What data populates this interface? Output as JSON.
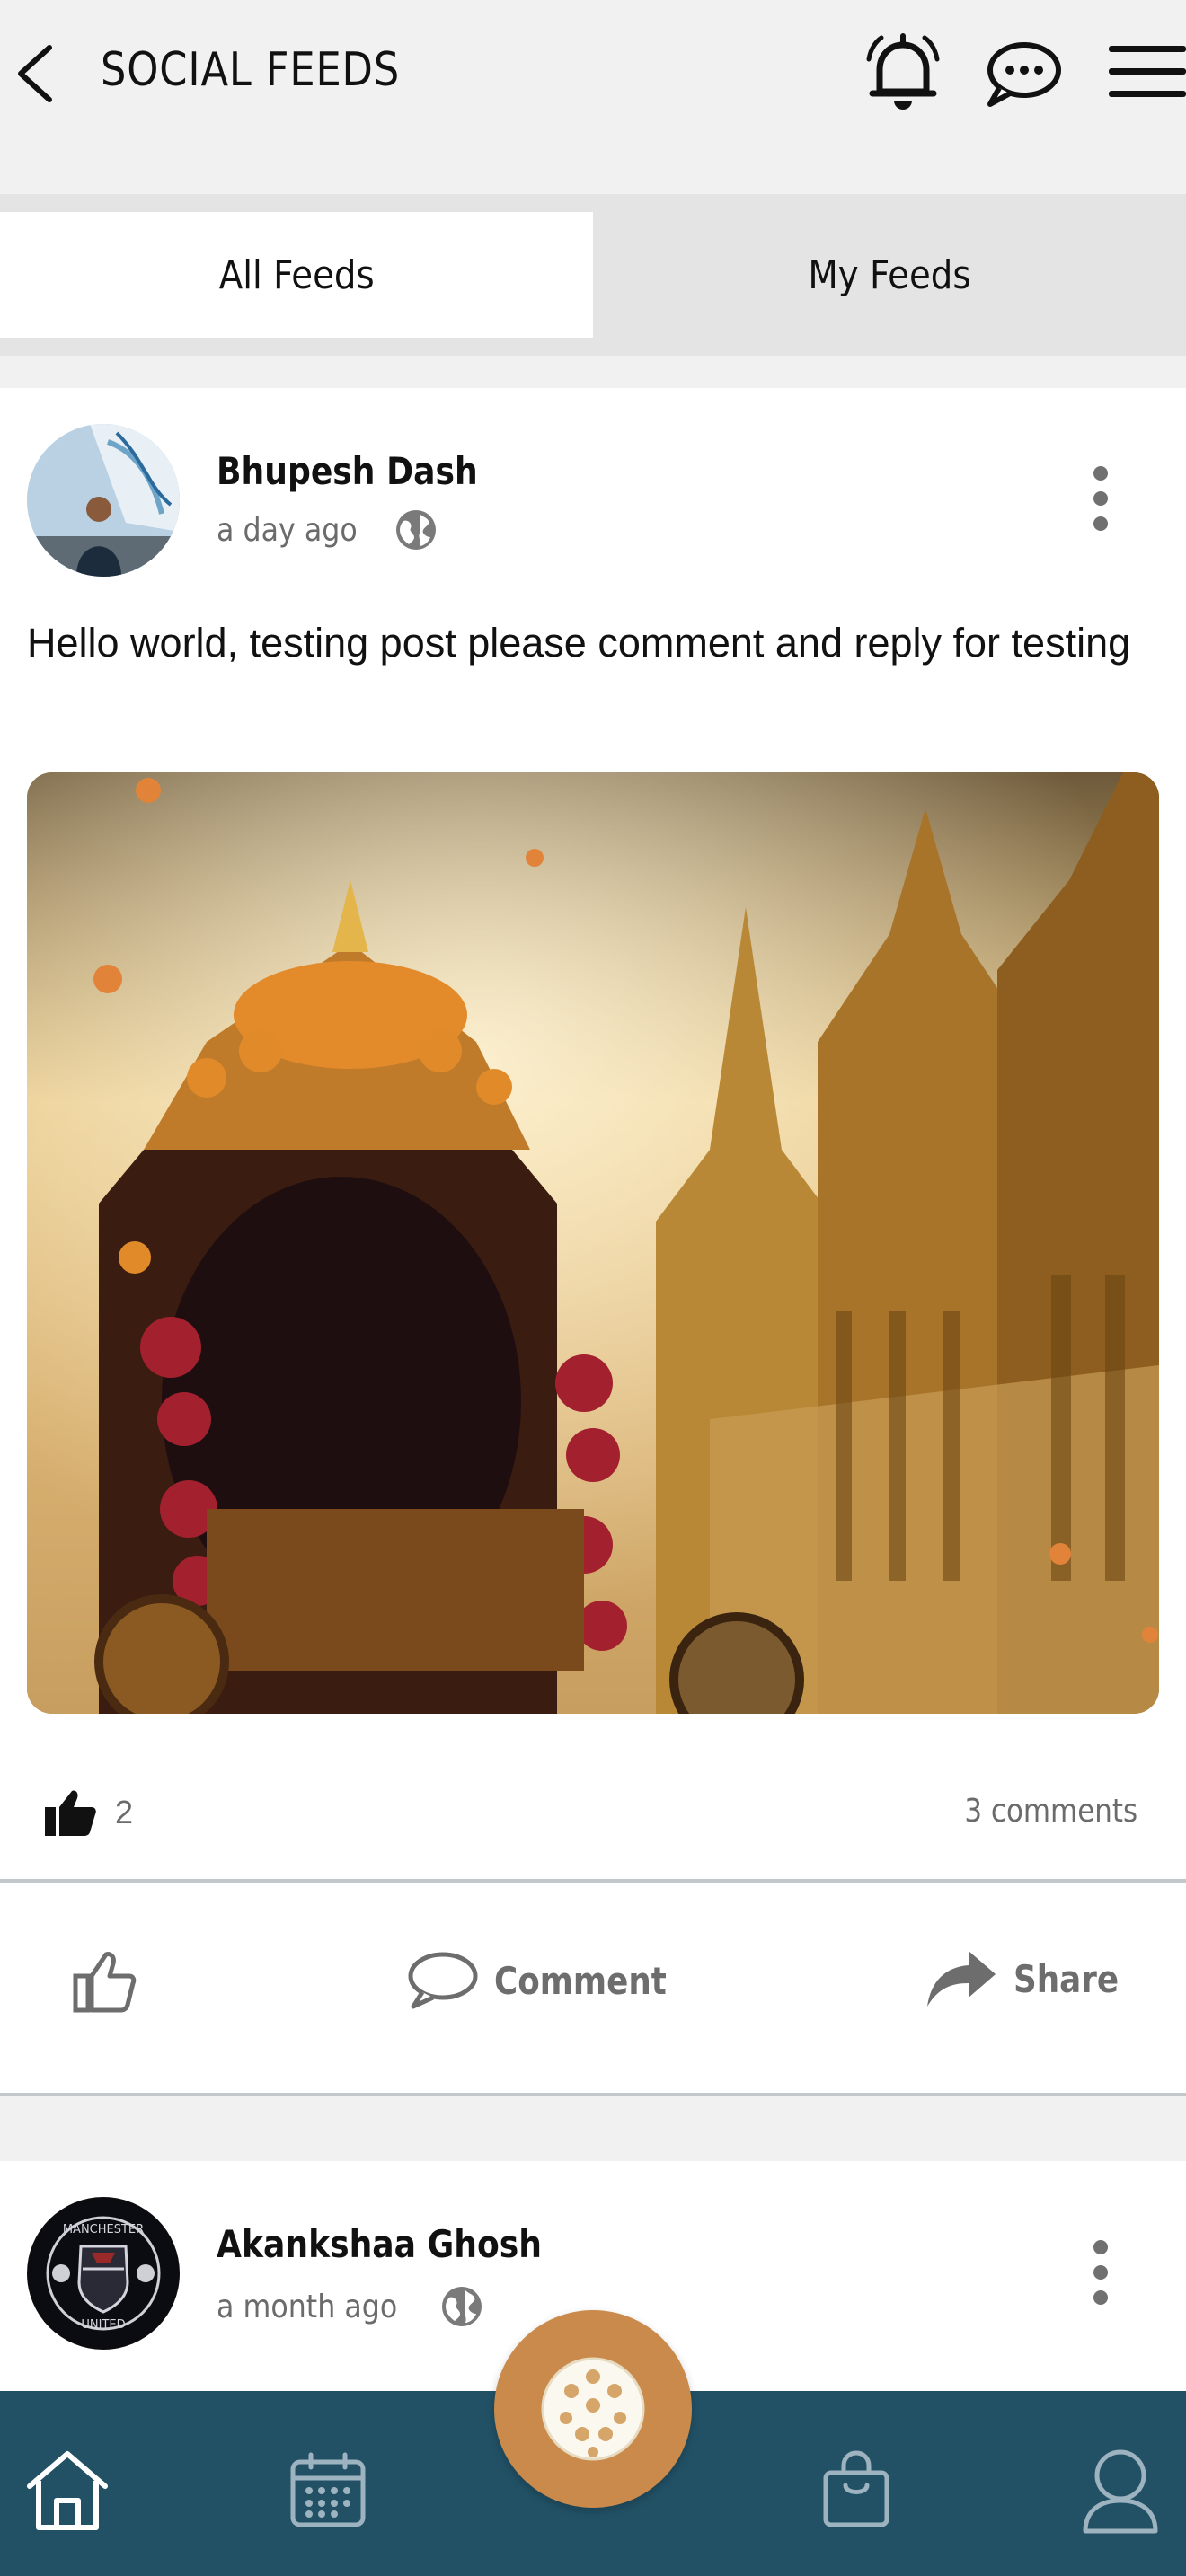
{
  "header": {
    "title": "SOCIAL FEEDS",
    "icons": [
      "back-arrow-icon",
      "bell-icon",
      "chat-bubble-icon",
      "hamburger-menu-icon"
    ]
  },
  "tabs": [
    {
      "label": "All Feeds",
      "active": true
    },
    {
      "label": "My Feeds",
      "active": false
    }
  ],
  "posts": [
    {
      "author": "Bhupesh Dash",
      "time": "a day ago",
      "visibility_icon": "globe-icon",
      "text": "Hello world, testing post please comment and reply for testing",
      "likes": "2",
      "comments": "3 comments",
      "actions": {
        "comment": "Comment",
        "share": "Share"
      }
    },
    {
      "author": "Akankshaa Ghosh",
      "time": "a month ago",
      "visibility_icon": "globe-icon",
      "avatar_text": "MANCHESTER UNITED"
    }
  ],
  "bottom_nav": {
    "items": [
      "home-icon",
      "calendar-icon",
      "pickleball-icon",
      "shopping-bag-icon",
      "profile-icon"
    ],
    "active": "home-icon"
  },
  "colors": {
    "nav_bg": "#225166",
    "fab": "#c98a4b",
    "background": "#f1f1f1"
  }
}
